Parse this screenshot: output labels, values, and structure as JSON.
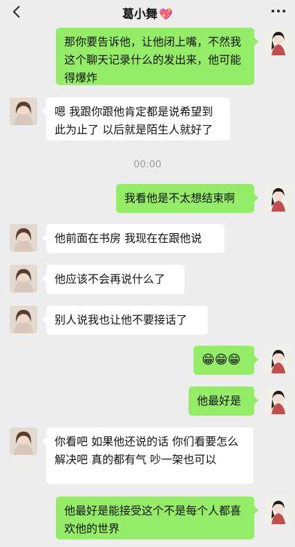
{
  "header": {
    "title": "葛小舞",
    "title_emoji": "💖",
    "back_icon": "back-chevron-icon",
    "more_icon": "more-dots-icon"
  },
  "timestamp": "00:00",
  "messages": [
    {
      "side": "right",
      "text": "那你要告诉他，让他闭上嘴，不然我这个聊天记录什么的发出来，他可能得爆炸"
    },
    {
      "side": "left",
      "text": "嗯 我跟你跟他肯定都是说希望到此为止了 以后就是陌生人就好了"
    },
    {
      "side": "right",
      "text": "我看他是不太想结束啊"
    },
    {
      "side": "left",
      "text": "他前面在书房 我现在在跟他说"
    },
    {
      "side": "left",
      "text": "他应该不会再说什么了"
    },
    {
      "side": "left",
      "text": "别人说我也让他不要接话了"
    },
    {
      "side": "right",
      "text": "😁😁😁"
    },
    {
      "side": "right",
      "text": "他最好是"
    },
    {
      "side": "left",
      "text": "你看吧 如果他还说的话 你们看要怎么解决吧 真的都有气 吵一架也可以"
    },
    {
      "side": "right",
      "text": "他最好是能接受这个不是每个人都喜欢他的世界"
    }
  ],
  "colors": {
    "background": "#ededed",
    "sent_bubble": "#95ec69",
    "received_bubble": "#ffffff",
    "timestamp": "#9c9c9c"
  }
}
